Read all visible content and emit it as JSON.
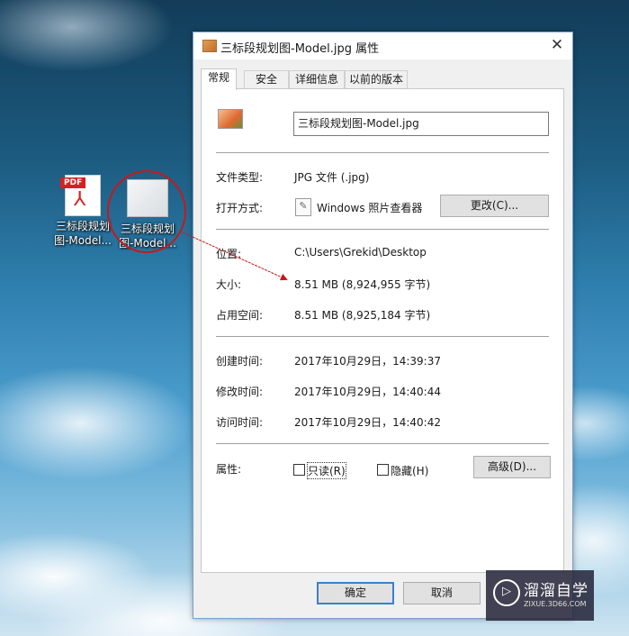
{
  "desktop": {
    "icons": [
      {
        "label_line1": "三标段规划",
        "label_line2": "图-Model...",
        "badge": "PDF"
      },
      {
        "label_line1": "三标段规划",
        "label_line2": "图-Model..."
      }
    ]
  },
  "dialog": {
    "title": "三标段规划图-Model.jpg 属性",
    "close_glyph": "✕",
    "tabs": [
      "常规",
      "安全",
      "详细信息",
      "以前的版本"
    ],
    "file_name": "三标段规划图-Model.jpg",
    "rows": {
      "file_type": {
        "label": "文件类型:",
        "value": "JPG 文件 (.jpg)"
      },
      "opens_with": {
        "label": "打开方式:",
        "value": "Windows 照片查看器",
        "button": "更改(C)..."
      },
      "location": {
        "label": "位置:",
        "value": "C:\\Users\\Grekid\\Desktop"
      },
      "size": {
        "label": "大小:",
        "value": "8.51 MB (8,924,955 字节)"
      },
      "size_on_disk": {
        "label": "占用空间:",
        "value": "8.51 MB (8,925,184 字节)"
      },
      "created": {
        "label": "创建时间:",
        "value": "2017年10月29日，14:39:37"
      },
      "modified": {
        "label": "修改时间:",
        "value": "2017年10月29日，14:40:44"
      },
      "accessed": {
        "label": "访问时间:",
        "value": "2017年10月29日，14:40:42"
      }
    },
    "attributes": {
      "label": "属性:",
      "readonly": {
        "label": "只读(R)",
        "checked": false
      },
      "hidden": {
        "label": "隐藏(H)",
        "checked": false
      },
      "advanced_button": "高级(D)..."
    },
    "buttons": {
      "ok": "确定",
      "cancel": "取消"
    }
  },
  "watermark": {
    "title": "溜溜自学",
    "subtitle": "ZIXUE.3D66.COM"
  },
  "colors": {
    "annotation_red": "#c41a1a",
    "focus_blue": "#3c7fd0"
  }
}
